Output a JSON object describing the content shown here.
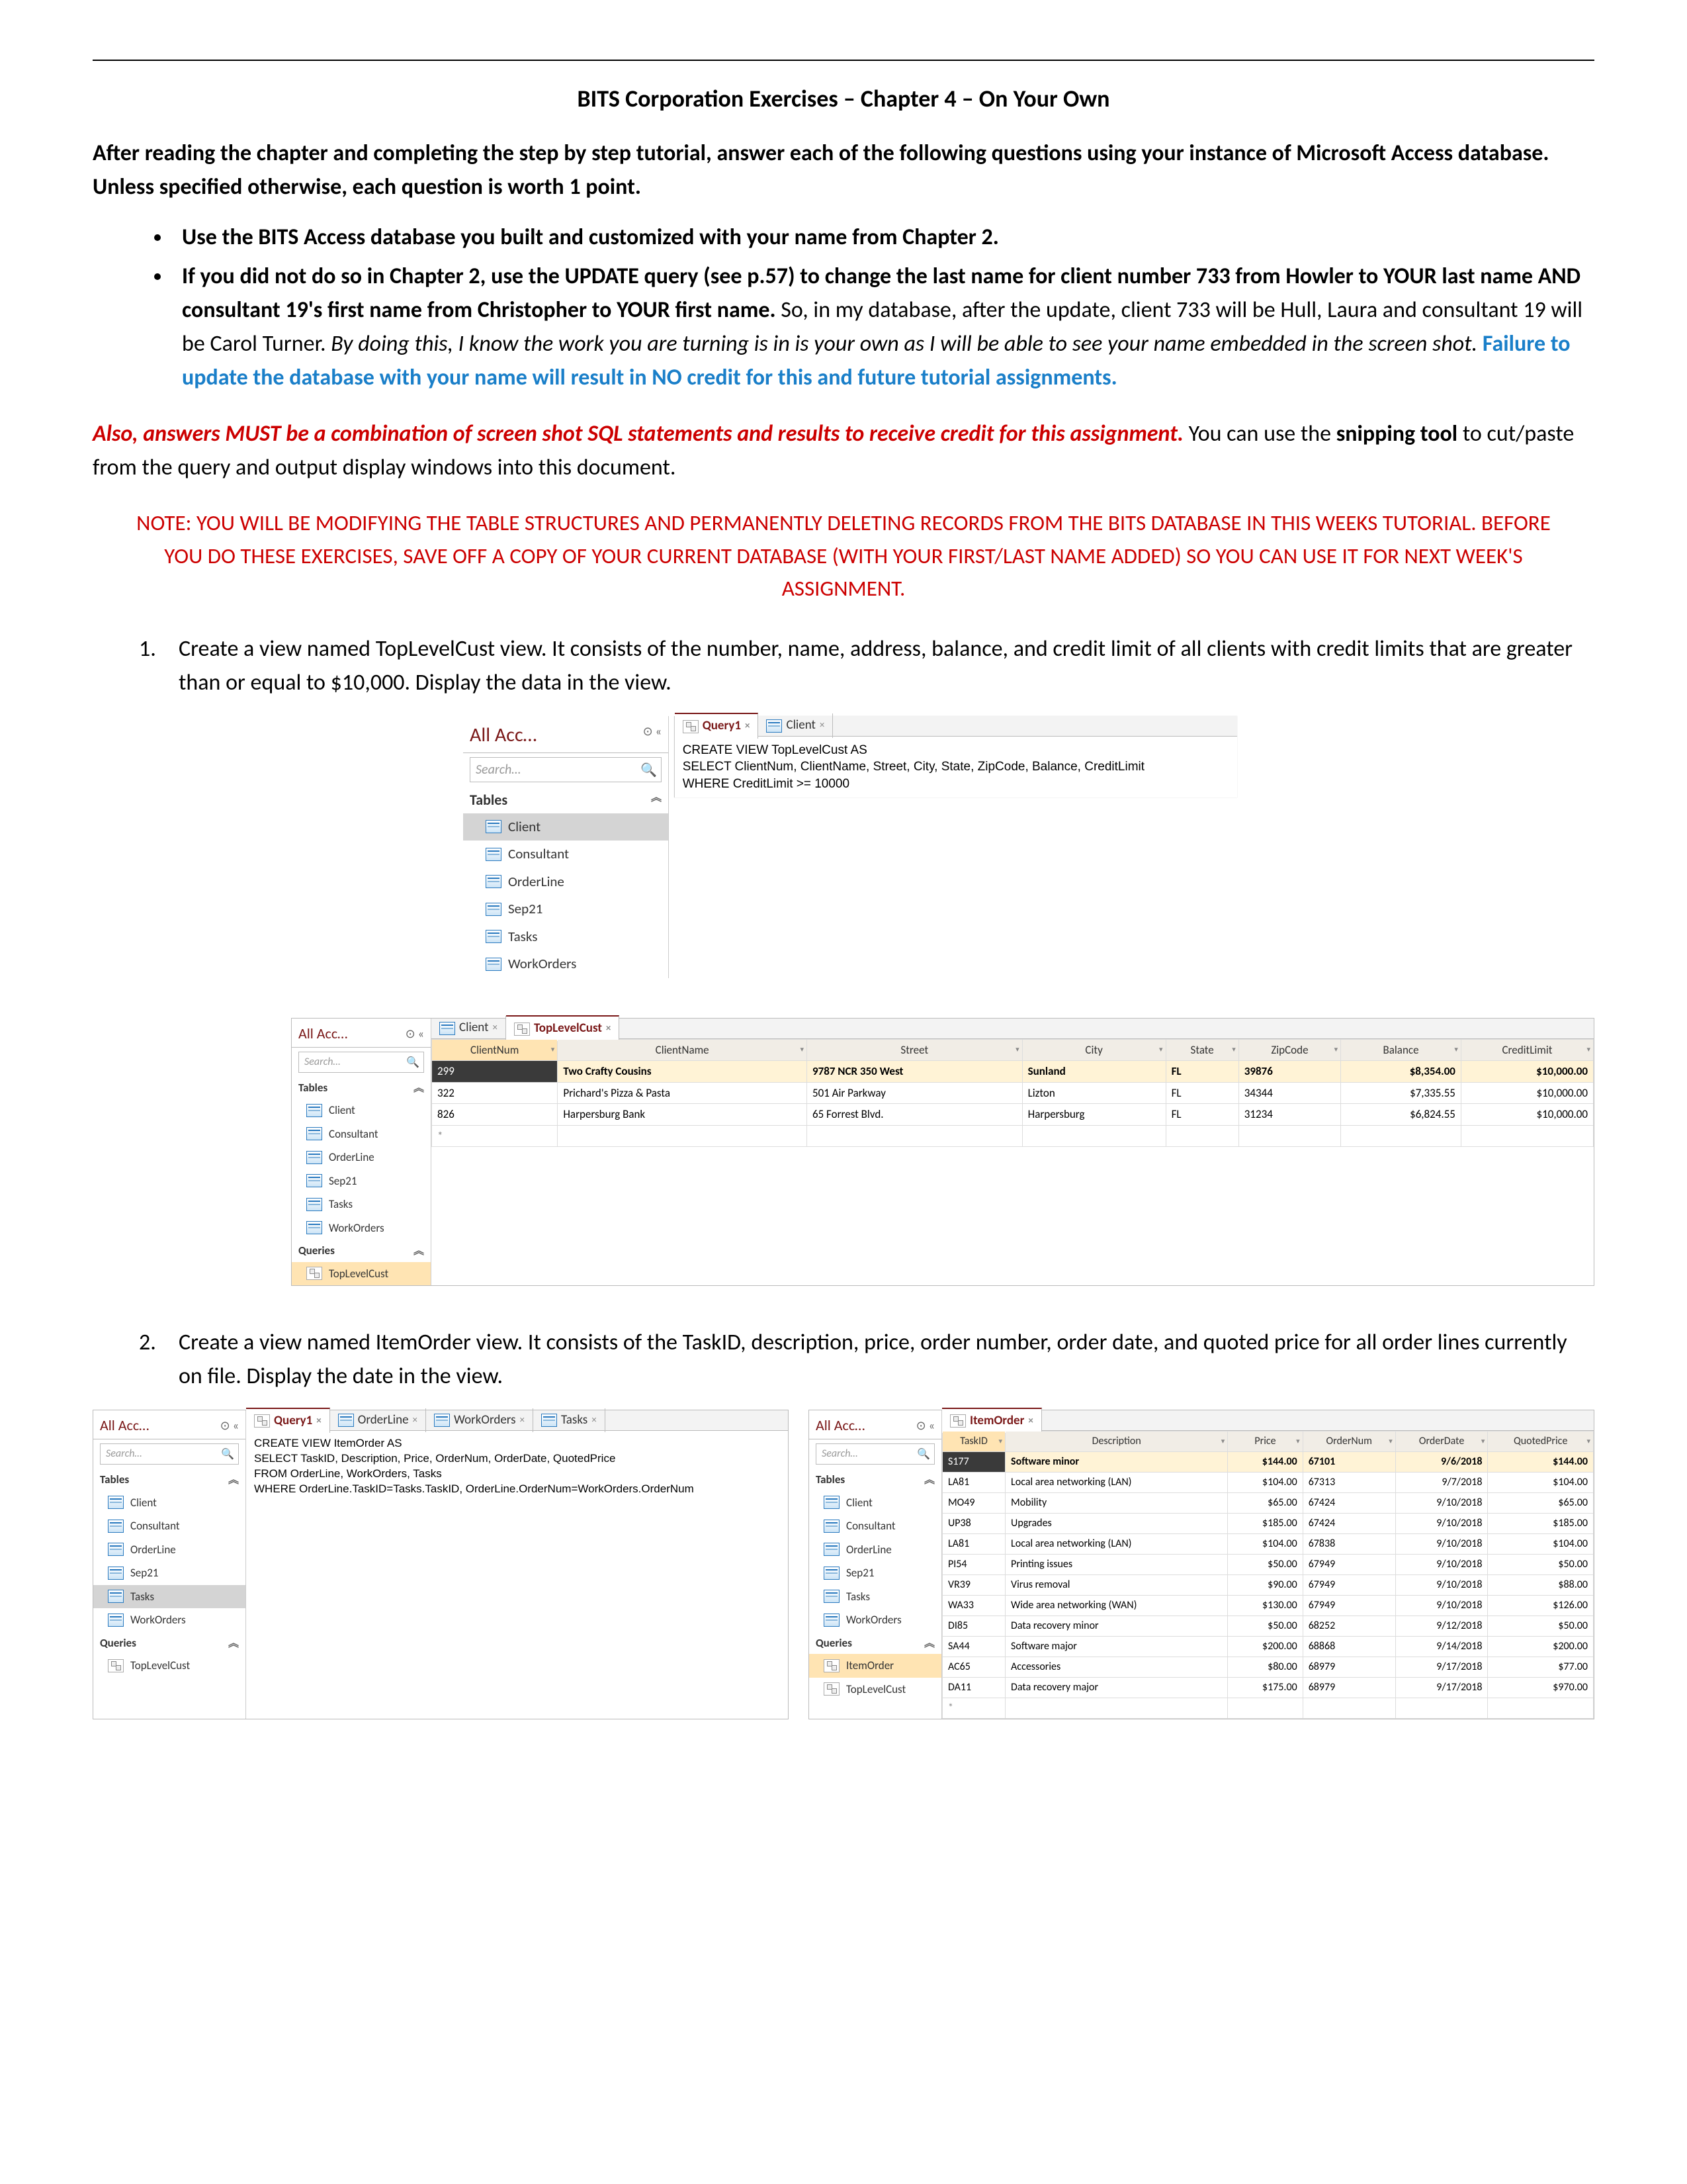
{
  "doc": {
    "title": "BITS Corporation Exercises – Chapter 4 – On Your Own",
    "intro": "After reading the chapter and completing the step by step tutorial, answer each of the following questions using your instance of Microsoft Access database.   Unless specified otherwise, each question is worth 1 point.",
    "bullets": [
      {
        "bold": "Use the BITS Access database you built and customized with your name from Chapter 2."
      },
      {
        "bold_prefix": "If you did not do so in Chapter 2, use the UPDATE query (see p.57) to change the last name for client number 733 from Howler to YOUR last name AND consultant 19's first name from Christopher to YOUR first name.",
        "plain": "  So, in my database, after the update, client 733 will be Hull, Laura and consultant 19 will be Carol Turner.  ",
        "italic": "By doing this, I know the work you are turning is in is your own as I will be able to see your name embedded in the screen shot.   ",
        "blue": "Failure to update the database with your name will result in NO credit for this and future tutorial assignments."
      }
    ],
    "also_red": "Also, answers MUST be a combination of screen shot SQL statements and results to receive credit for this assignment.",
    "also_rest1": "  You can use the ",
    "also_bold": "snipping tool",
    "also_rest2": " to cut/paste from the query and output display windows into this document.",
    "note": "NOTE: YOU WILL BE MODIFYING THE TABLE STRUCTURES AND PERMANENTLY DELETING RECORDS FROM THE BITS DATABASE IN THIS WEEKS TUTORIAL.  BEFORE YOU DO THESE EXERCISES, SAVE OFF A COPY OF YOUR CURRENT DATABASE (WITH YOUR FIRST/LAST NAME ADDED) SO YOU CAN USE IT FOR NEXT WEEK'S ASSIGNMENT.",
    "q1": "Create a view named TopLevelCust view.  It consists of the number, name, address, balance, and credit limit of all clients with credit limits that are greater than or equal to $10,000.  Display the data in the view.",
    "q2": "Create a view named ItemOrder view. It consists of the TaskID, description, price, order number, order date, and quoted price for all order lines currently on file.  Display the date in the view."
  },
  "nav": {
    "title": "All Acc…",
    "ctrl": "⊙  «",
    "search_ph": "Search…",
    "group_tables": "Tables",
    "group_queries": "Queries",
    "tables": [
      "Client",
      "Consultant",
      "OrderLine",
      "Sep21",
      "Tasks",
      "WorkOrders"
    ],
    "queries": [
      "TopLevelCust"
    ],
    "queries2": [
      "ItemOrder",
      "TopLevelCust"
    ]
  },
  "tabs1": {
    "a": "Query1",
    "b": "Client"
  },
  "sql1": "CREATE VIEW TopLevelCust AS\nSELECT ClientNum, ClientName, Street, City, State, ZipCode, Balance, CreditLimit\nWHERE CreditLimit >= 10000",
  "tabs2": {
    "a": "Client",
    "b": "TopLevelCust"
  },
  "grid1": {
    "cols": [
      "ClientNum",
      "ClientName",
      "Street",
      "City",
      "State",
      "ZipCode",
      "Balance",
      "CreditLimit"
    ],
    "rows": [
      [
        "299",
        "Two Crafty Cousins",
        "9787 NCR 350 West",
        "Sunland",
        "FL",
        "39876",
        "$8,354.00",
        "$10,000.00"
      ],
      [
        "322",
        "Prichard's Pizza & Pasta",
        "501 Air Parkway",
        "Lizton",
        "FL",
        "34344",
        "$7,335.55",
        "$10,000.00"
      ],
      [
        "826",
        "Harpersburg Bank",
        "65 Forrest Blvd.",
        "Harpersburg",
        "FL",
        "31234",
        "$6,824.55",
        "$10,000.00"
      ]
    ]
  },
  "tabs3": {
    "a": "Query1",
    "b": "OrderLine",
    "c": "WorkOrders",
    "d": "Tasks"
  },
  "sql2": "CREATE VIEW ItemOrder AS\nSELECT TaskID, Description, Price, OrderNum, OrderDate, QuotedPrice\nFROM OrderLine, WorkOrders, Tasks\nWHERE OrderLine.TaskID=Tasks.TaskID, OrderLine.OrderNum=WorkOrders.OrderNum",
  "tabs4": {
    "a": "ItemOrder"
  },
  "grid2": {
    "cols": [
      "TaskID",
      "Description",
      "Price",
      "OrderNum",
      "OrderDate",
      "QuotedPrice"
    ],
    "rows": [
      [
        "S177",
        "Software minor",
        "$144.00",
        "67101",
        "9/6/2018",
        "$144.00"
      ],
      [
        "LA81",
        "Local area networking (LAN)",
        "$104.00",
        "67313",
        "9/7/2018",
        "$104.00"
      ],
      [
        "MO49",
        "Mobility",
        "$65.00",
        "67424",
        "9/10/2018",
        "$65.00"
      ],
      [
        "UP38",
        "Upgrades",
        "$185.00",
        "67424",
        "9/10/2018",
        "$185.00"
      ],
      [
        "LA81",
        "Local area networking (LAN)",
        "$104.00",
        "67838",
        "9/10/2018",
        "$104.00"
      ],
      [
        "PI54",
        "Printing issues",
        "$50.00",
        "67949",
        "9/10/2018",
        "$50.00"
      ],
      [
        "VR39",
        "Virus removal",
        "$90.00",
        "67949",
        "9/10/2018",
        "$88.00"
      ],
      [
        "WA33",
        "Wide area networking (WAN)",
        "$130.00",
        "67949",
        "9/10/2018",
        "$126.00"
      ],
      [
        "DI85",
        "Data recovery minor",
        "$50.00",
        "68252",
        "9/12/2018",
        "$50.00"
      ],
      [
        "SA44",
        "Software major",
        "$200.00",
        "68868",
        "9/14/2018",
        "$200.00"
      ],
      [
        "AC65",
        "Accessories",
        "$80.00",
        "68979",
        "9/17/2018",
        "$77.00"
      ],
      [
        "DA11",
        "Data recovery major",
        "$175.00",
        "68979",
        "9/17/2018",
        "$970.00"
      ]
    ]
  }
}
